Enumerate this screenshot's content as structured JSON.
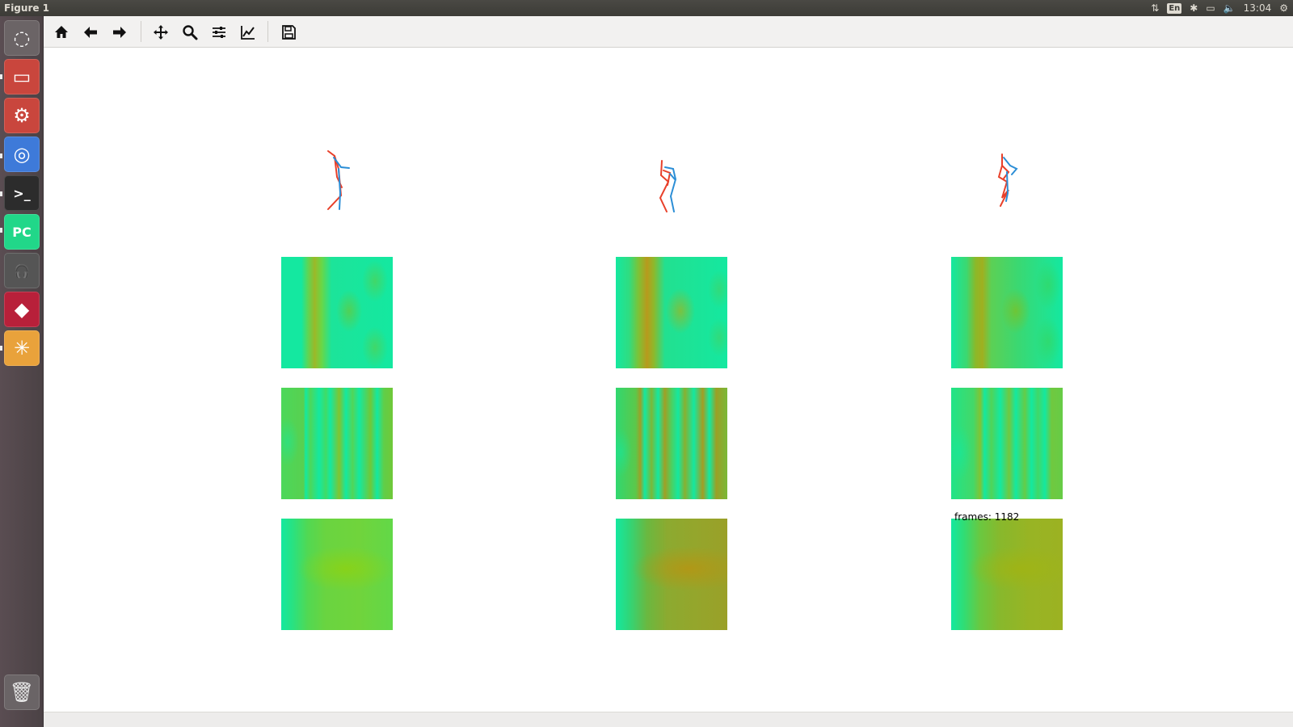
{
  "window": {
    "title": "Figure 1"
  },
  "indicators": {
    "network": "⇅",
    "keyboard": "En",
    "bluetooth": "✱",
    "battery": "▭",
    "volume": "🔈",
    "time": "13:04",
    "settings": "⚙"
  },
  "launcher": {
    "items": [
      {
        "name": "dash-icon",
        "glyph": "◌",
        "color": "#6b6466"
      },
      {
        "name": "files-icon",
        "glyph": "▭",
        "color": "#c9463d"
      },
      {
        "name": "system-settings-icon",
        "glyph": "⚙",
        "color": "#c9463d"
      },
      {
        "name": "chromium-icon",
        "glyph": "◎",
        "color": "#3e7ad9"
      },
      {
        "name": "terminal-icon",
        "glyph": ">_",
        "color": "#2c2c2c"
      },
      {
        "name": "pycharm-icon",
        "glyph": "PC",
        "color": "#21d789"
      },
      {
        "name": "headphones-icon",
        "glyph": "🎧",
        "color": "#555555"
      },
      {
        "name": "mendeley-icon",
        "glyph": "◆",
        "color": "#b8203a"
      },
      {
        "name": "pinwheel-icon",
        "glyph": "✳",
        "color": "#e9a23b"
      }
    ],
    "trash": {
      "name": "trash-icon",
      "glyph": "🗑"
    }
  },
  "toolbar": {
    "buttons": [
      "home",
      "back",
      "forward",
      "pan",
      "zoom",
      "configure-subplots",
      "edit-axis",
      "save"
    ]
  },
  "figure": {
    "frames_label": "frames: 1182"
  },
  "colors": {
    "skeleton_left": "#e8402a",
    "skeleton_right": "#2c8ed6"
  }
}
